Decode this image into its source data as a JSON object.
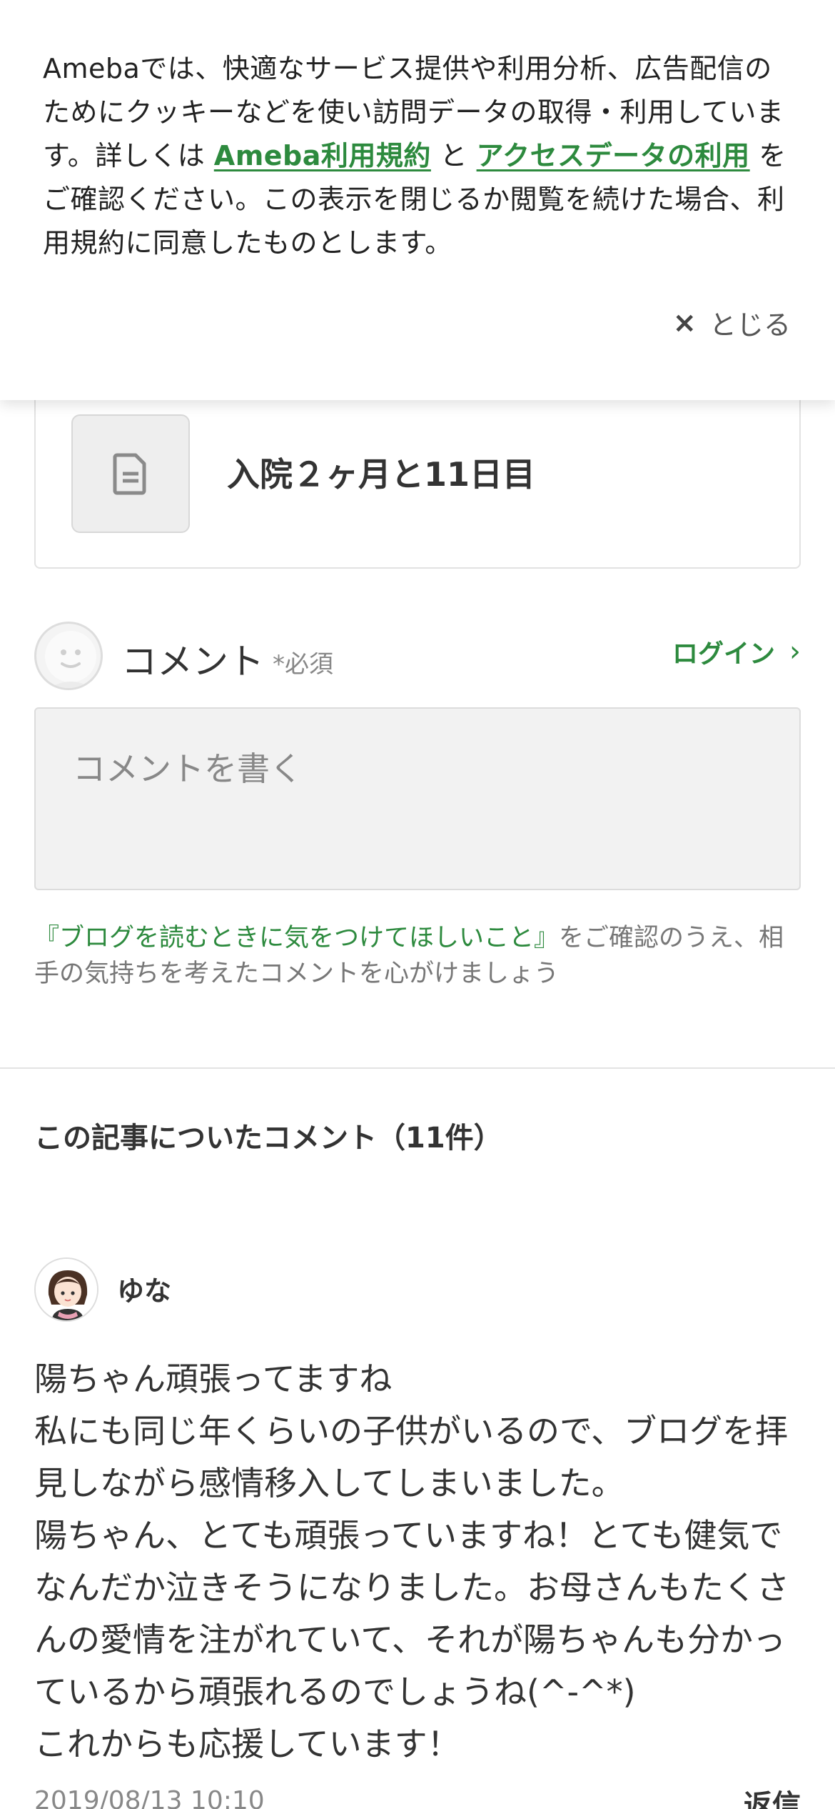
{
  "cookie_banner": {
    "text_before": "Amebaでは、快適なサービス提供や利用分析、広告配信のためにクッキーなどを使い訪問データの取得・利用しています。詳しくは ",
    "link_terms": "Ameba利用規約",
    "text_mid": " と ",
    "link_access": "アクセスデータの利用",
    "text_after": " をご確認ください。この表示を閉じるか閲覧を続けた場合、利用規約に同意したものとします。",
    "close_icon": "×",
    "close_label": "とじる"
  },
  "article_card": {
    "thumbnail_icon": "document-icon",
    "title": "入院２ヶ月と11日目"
  },
  "comment_form": {
    "label": "コメント",
    "required": "*必須",
    "login_label": "ログイン",
    "login_chevron": "›",
    "placeholder": "コメントを書く",
    "guideline_link": "『ブログを読むときに気をつけてほしいこと』",
    "guideline_text": "をご確認のうえ、相手の気持ちを考えたコメントを心がけましょう"
  },
  "comments": {
    "title": "この記事についたコメント（11件）",
    "items": [
      {
        "author": "ゆな",
        "lines": [
          "陽ちゃん頑張ってますね",
          "私にも同じ年くらいの子供がいるので、ブログを拝見しながら感情移入してしまいました。",
          "陽ちゃん、とても頑張っていますね！とても健気でなんだか泣きそうになりました。お母さんもたくさんの愛情を注がれていて、それが陽ちゃんも分かっているから頑張れるのでしょうね(^-^*)",
          "これからも応援しています！"
        ],
        "date": "2019/08/13 10:10",
        "reply_label": "返信"
      }
    ]
  },
  "colors": {
    "accent_green": "#2d8a3e",
    "text": "#333333",
    "muted": "#888888"
  }
}
